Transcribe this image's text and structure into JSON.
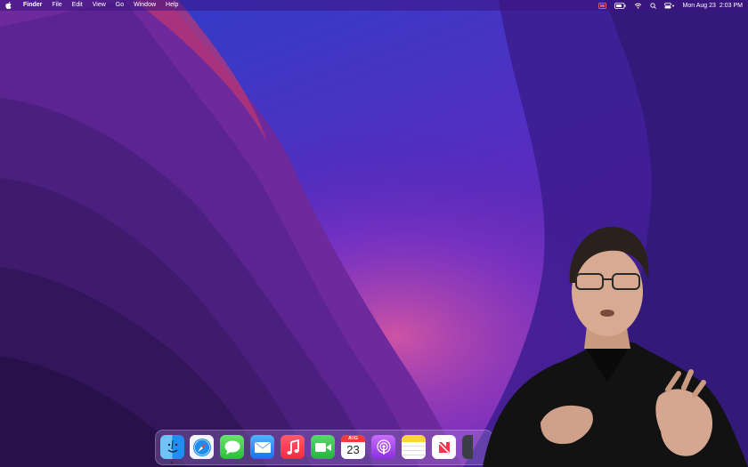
{
  "menubar": {
    "apple_icon": "apple-logo-icon",
    "app_name": "Finder",
    "menus": [
      "File",
      "Edit",
      "View",
      "Go",
      "Window",
      "Help"
    ],
    "status_icons": [
      "screen-recording-icon",
      "battery-icon",
      "wifi-icon",
      "spotlight-search-icon",
      "control-center-icon"
    ],
    "date": "Mon Aug 23",
    "time": "2:03 PM"
  },
  "dock": {
    "apps": [
      {
        "name": "Finder",
        "icon": "finder-icon",
        "running": true
      },
      {
        "name": "Safari",
        "icon": "safari-icon",
        "running": false
      },
      {
        "name": "Messages",
        "icon": "messages-icon",
        "running": false
      },
      {
        "name": "Mail",
        "icon": "mail-icon",
        "running": false
      },
      {
        "name": "Music",
        "icon": "music-icon",
        "running": false
      },
      {
        "name": "FaceTime",
        "icon": "facetime-icon",
        "running": false
      },
      {
        "name": "Calendar",
        "icon": "calendar-icon",
        "running": false
      },
      {
        "name": "Podcasts",
        "icon": "podcasts-icon",
        "running": false
      },
      {
        "name": "Notes",
        "icon": "notes-icon",
        "running": false
      },
      {
        "name": "News",
        "icon": "news-icon",
        "running": false
      }
    ],
    "calendar_month": "AUG",
    "calendar_day": "23"
  },
  "colors": {
    "wallpaper_dark": "#2a1a6b",
    "wallpaper_purple": "#4a1f9e",
    "wallpaper_magenta": "#b4309c",
    "accent_red": "#f23a3a"
  }
}
